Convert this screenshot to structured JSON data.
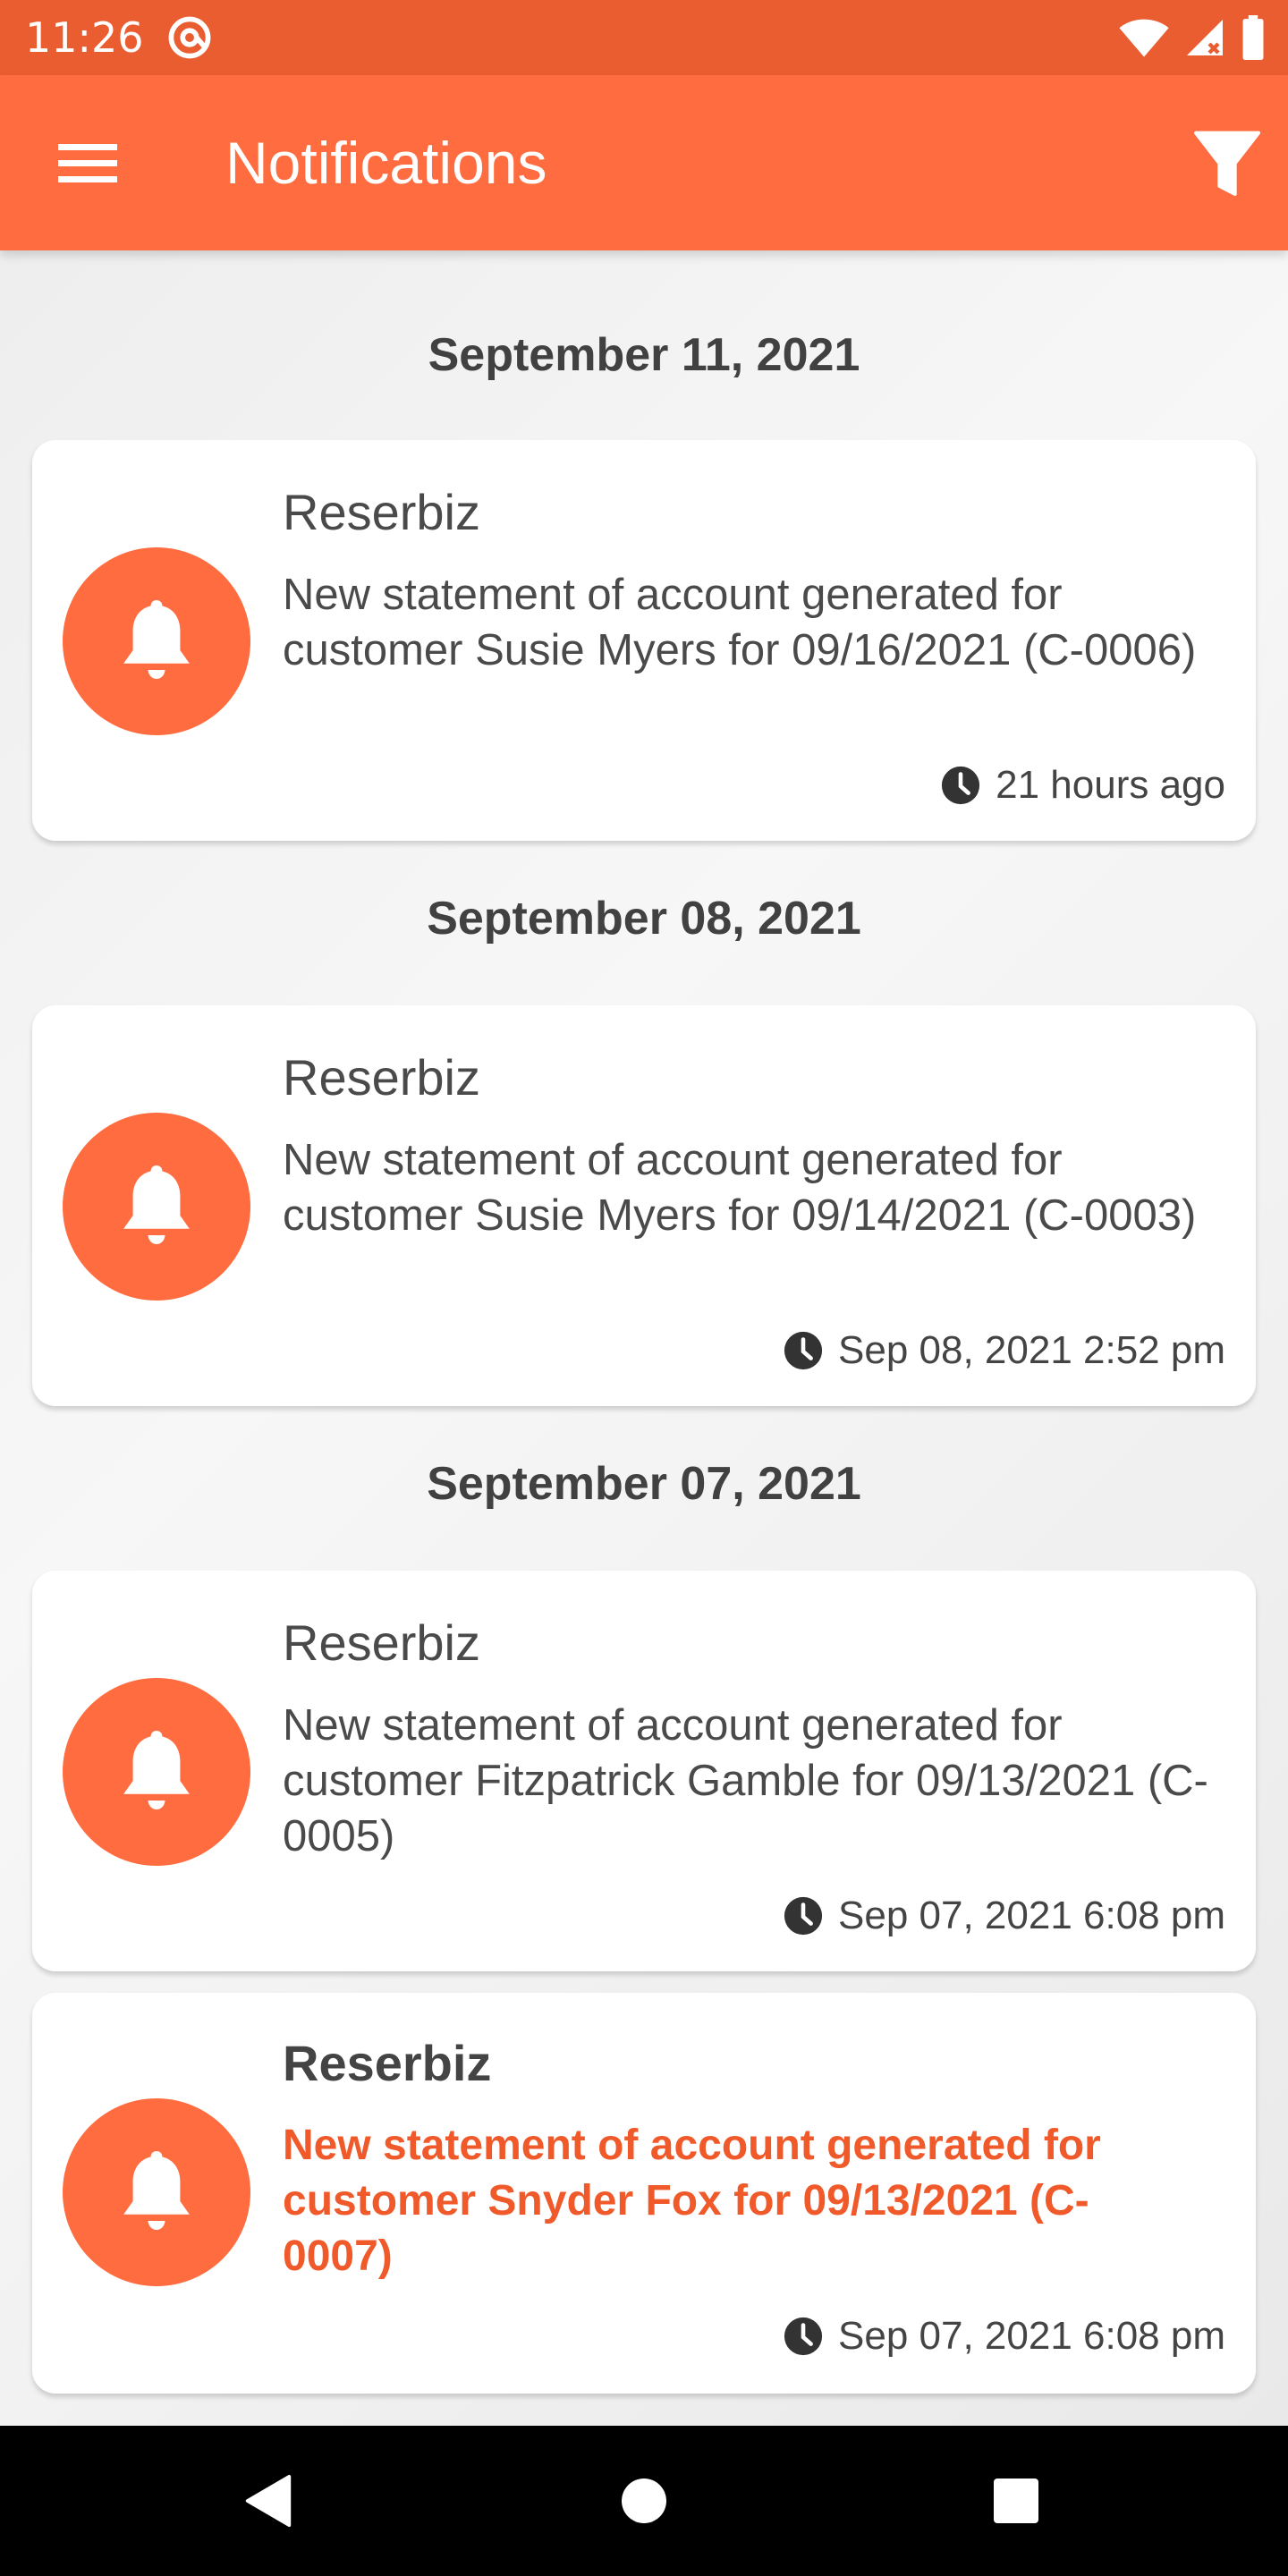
{
  "status_bar": {
    "time": "11:26",
    "icons": [
      "at-sign-icon",
      "wifi-icon",
      "signal-icon",
      "battery-icon"
    ]
  },
  "app_bar": {
    "title": "Notifications",
    "menu_icon": "hamburger-menu-icon",
    "filter_icon": "filter-icon",
    "color": "#ff6c3f",
    "status_color": "#ea5d31"
  },
  "groups": [
    {
      "date": "September 11, 2021",
      "notifications": [
        {
          "sender": "Reserbiz",
          "message": "New statement of account generated for customer Susie Myers for 09/16/2021 (C-0006)",
          "time": "21 hours ago",
          "unread": false
        }
      ]
    },
    {
      "date": "September 08, 2021",
      "notifications": [
        {
          "sender": "Reserbiz",
          "message": "New statement of account generated for customer Susie Myers for 09/14/2021 (C-0003)",
          "time": "Sep 08, 2021 2:52 pm",
          "unread": false
        }
      ]
    },
    {
      "date": "September 07, 2021",
      "notifications": [
        {
          "sender": "Reserbiz",
          "message": "New statement of account generated for customer Fitzpatrick Gamble for 09/13/2021 (C-0005)",
          "time": "Sep 07, 2021 6:08 pm",
          "unread": false
        },
        {
          "sender": "Reserbiz",
          "message": "New statement of account generated for customer Snyder Fox for 09/13/2021 (C-0007)",
          "time": "Sep 07, 2021 6:08 pm",
          "unread": true
        }
      ]
    }
  ],
  "accent_color": "#ff6c3f",
  "unread_text_color": "#f05a2b",
  "nav_bar": {
    "icons": [
      "back-icon",
      "home-icon",
      "recents-icon"
    ]
  }
}
